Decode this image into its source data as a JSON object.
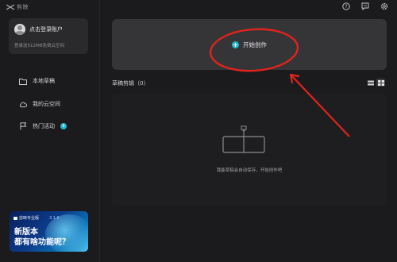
{
  "app": {
    "name": "剪映"
  },
  "window_icons": [
    "help-icon",
    "feedback-icon",
    "settings-icon"
  ],
  "login": {
    "label": "点击登录账户",
    "subtext": "登录送512MB免费云空间"
  },
  "nav": [
    {
      "name": "nav-local-drafts",
      "icon": "folder-icon",
      "label": "本地草稿"
    },
    {
      "name": "nav-cloud-space",
      "icon": "cloud-icon",
      "label": "我的云空间"
    },
    {
      "name": "nav-hot-activities",
      "icon": "flag-icon",
      "label": "热门活动",
      "badge": "6"
    }
  ],
  "promo": {
    "brand": "剪映专业版",
    "version": "3.1.0",
    "line1": "新版本",
    "line2": "都有啥功能呢？"
  },
  "create": {
    "label": "开始创作"
  },
  "drafts": {
    "title": "草稿剪辑（0）",
    "empty_text": "我能草稿会自动保存，开始创作吧"
  },
  "colors": {
    "accent": "#22b8cf",
    "annotation": "#e0231c"
  }
}
